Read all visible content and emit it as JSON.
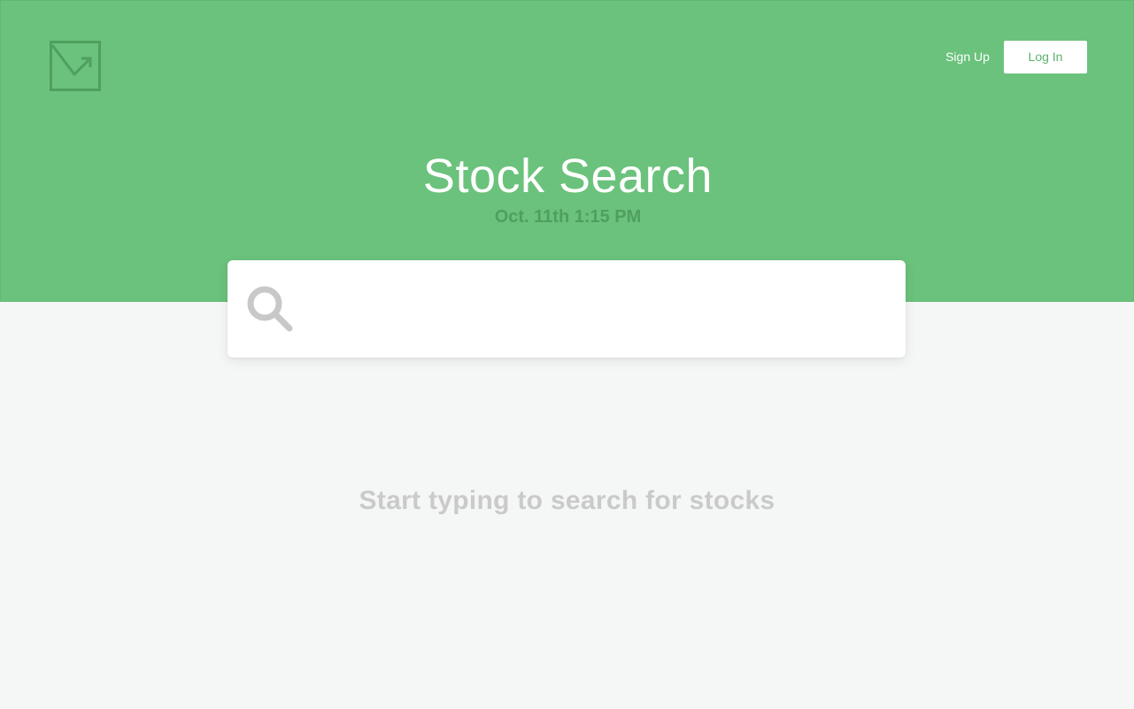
{
  "header": {
    "logo_icon": "chart-up-arrow-icon",
    "signup_label": "Sign Up",
    "login_label": "Log In"
  },
  "hero": {
    "title": "Stock Search",
    "datetime": "Oct. 11th 1:15 PM"
  },
  "search": {
    "icon": "search-icon",
    "value": "",
    "placeholder": ""
  },
  "empty_state": {
    "message": "Start typing to search for stocks"
  },
  "colors": {
    "hero_green": "#6bc27c",
    "accent_green": "#5bb26d",
    "page_background": "#f5f7f6",
    "muted_text": "#cacaca"
  }
}
